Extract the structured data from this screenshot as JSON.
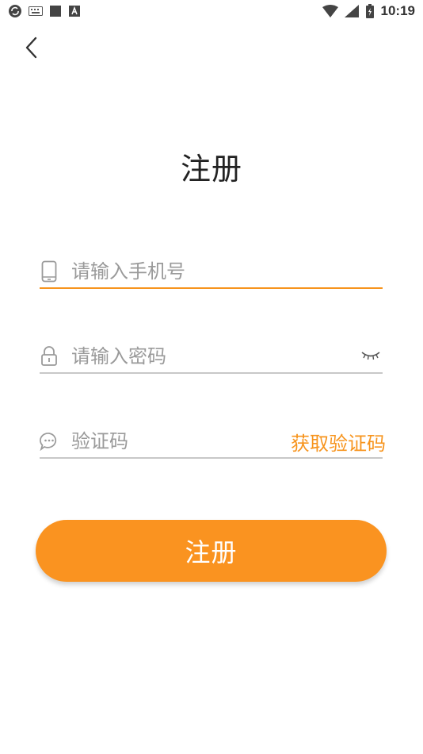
{
  "status_bar": {
    "time": "10:19",
    "left_icons": [
      "sync-icon",
      "keyboard-icon",
      "square-icon",
      "a-icon"
    ],
    "right_icons": [
      "wifi-icon",
      "signal-icon",
      "battery-icon"
    ]
  },
  "header": {
    "back_icon": "chevron-left-icon"
  },
  "page": {
    "title": "注册"
  },
  "form": {
    "phone": {
      "icon": "phone-icon",
      "placeholder": "请输入手机号",
      "value": ""
    },
    "password": {
      "icon": "lock-icon",
      "placeholder": "请输入密码",
      "value": "",
      "toggle_icon": "eye-closed-icon"
    },
    "code": {
      "icon": "message-icon",
      "placeholder": "验证码",
      "value": "",
      "get_code_label": "获取验证码"
    }
  },
  "register_button": {
    "label": "注册"
  },
  "colors": {
    "accent": "#fa9320",
    "accent_text": "#f7941d",
    "underline": "#c8c8c8",
    "placeholder": "#9a9a9a"
  }
}
